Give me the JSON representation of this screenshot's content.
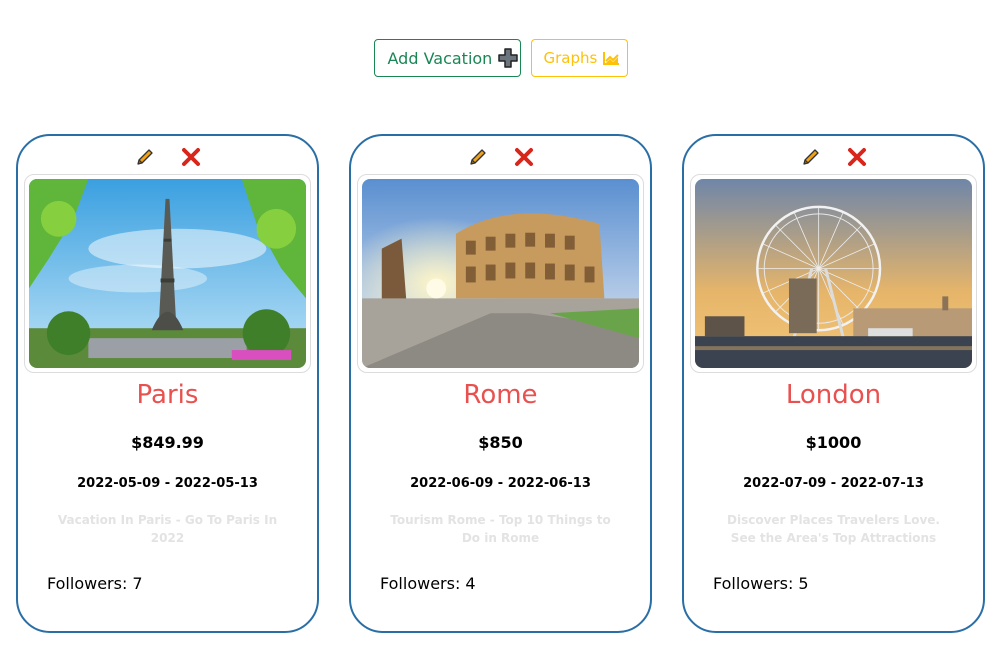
{
  "toolbar": {
    "add_label": "Add Vacation",
    "add_icon": "plus-icon",
    "graphs_label": "Graphs",
    "graphs_icon": "chart-line-icon"
  },
  "colors": {
    "card_border": "#2a6ea6",
    "city_title": "#e8514f",
    "add_button": "#198754",
    "graphs_button": "#ffc107",
    "edit_icon": "#f0a21a",
    "delete_icon": "#d9261c",
    "description": "#e3e3e3"
  },
  "vacations": [
    {
      "city": "Paris",
      "price": "$849.99",
      "dates": "2022-05-09 - 2022-05-13",
      "description": "Vacation In Paris - Go To Paris In 2022",
      "followers_label": "Followers: 7",
      "image": "eiffel-tower-photo"
    },
    {
      "city": "Rome",
      "price": "$850",
      "dates": "2022-06-09 - 2022-06-13",
      "description": "Tourism Rome - Top 10 Things to Do in Rome",
      "followers_label": "Followers: 4",
      "image": "colosseum-photo"
    },
    {
      "city": "London",
      "price": "$1000",
      "dates": "2022-07-09 - 2022-07-13",
      "description": "Discover Places Travelers Love. See the Area's Top Attractions",
      "followers_label": "Followers: 5",
      "image": "london-eye-photo"
    }
  ]
}
